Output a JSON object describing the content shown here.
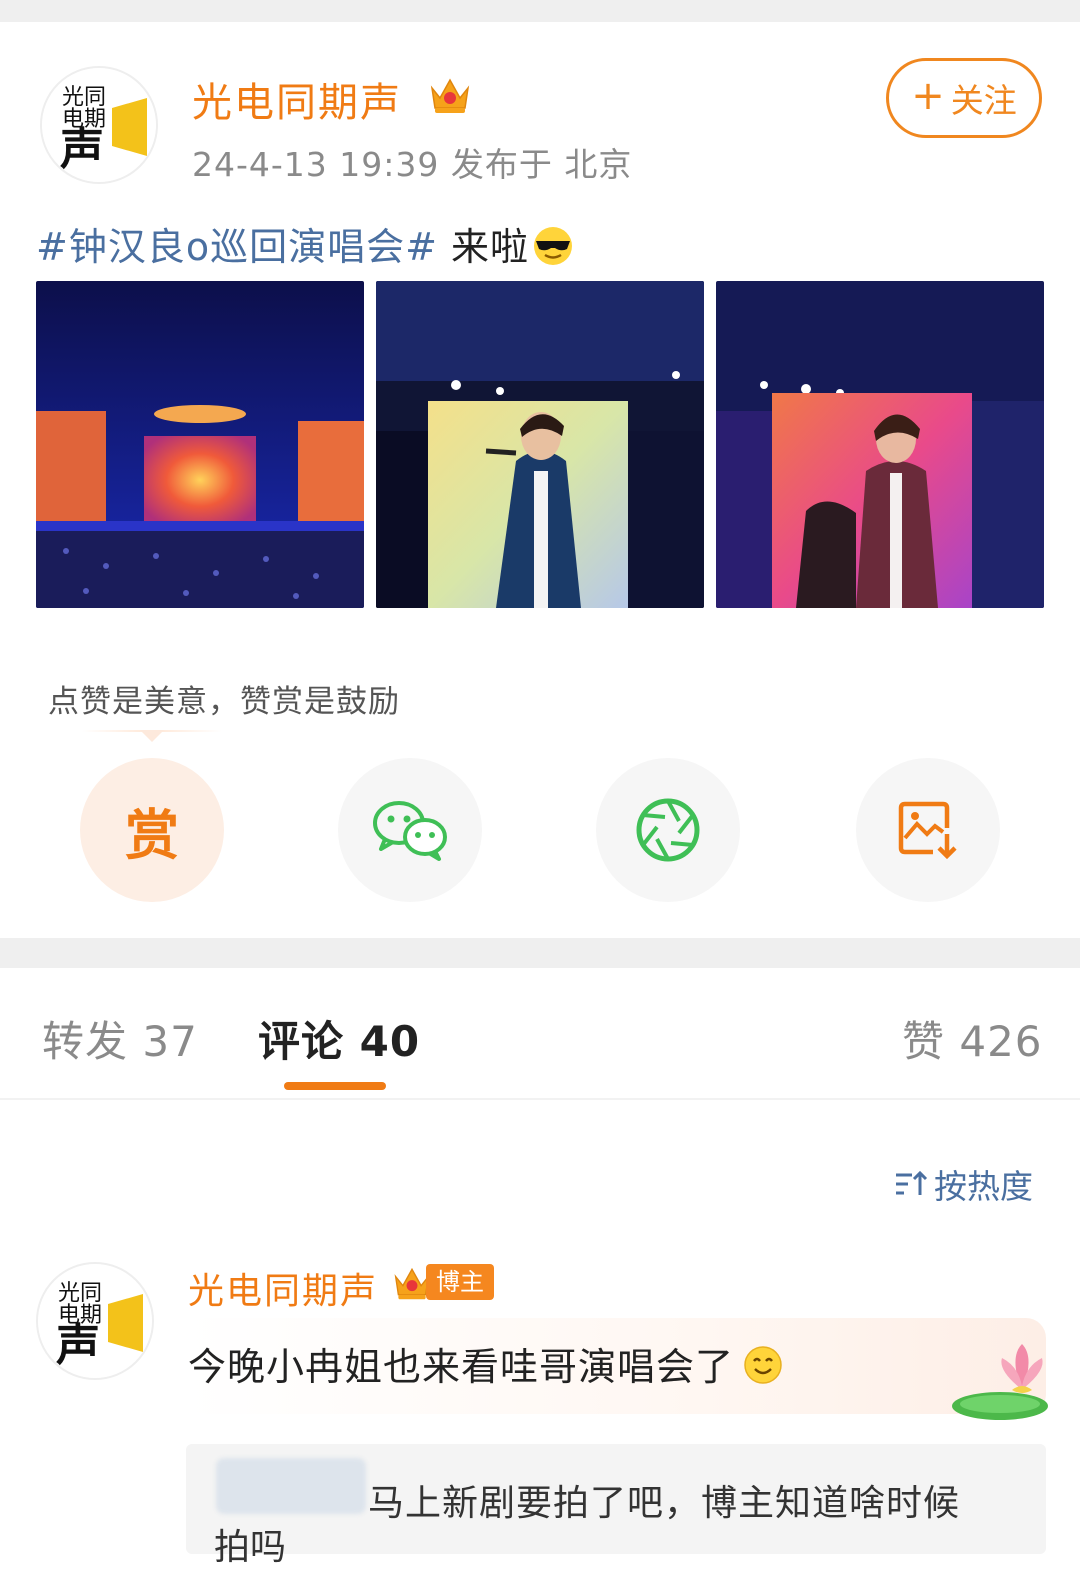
{
  "post": {
    "author": "光电同期声",
    "meta": "24-4-13 19:39  发布于 北京",
    "follow_label": "关注",
    "follow_plus": "+",
    "hashtag": "#钟汉良o巡回演唱会#",
    "text": " 来啦",
    "avatar_text_top": "光同",
    "avatar_text_mid": "电期",
    "avatar_text_big": "声"
  },
  "tip": "点赞是美意，赞赏是鼓励",
  "actions": {
    "reward_label": "赏"
  },
  "tabs": {
    "repost": "转发 37",
    "comments": "评论 40",
    "likes": "赞 426"
  },
  "sort_label": "按热度",
  "comment": {
    "author": "光电同期声",
    "badge": "博主",
    "text": "今晚小冉姐也来看哇哥演唱会了",
    "reply_text": "马上新剧要拍了吧，博主知道啥时候",
    "reply_cont": "拍吗"
  },
  "colors": {
    "accent_orange": "#f07b14",
    "link_blue": "#4a6fa0"
  },
  "icons": [
    "crown-icon",
    "sunglasses-emoji",
    "wechat-icon",
    "moments-icon",
    "save-image-icon",
    "sort-icon",
    "smile-emoji",
    "lotus-decoration"
  ]
}
